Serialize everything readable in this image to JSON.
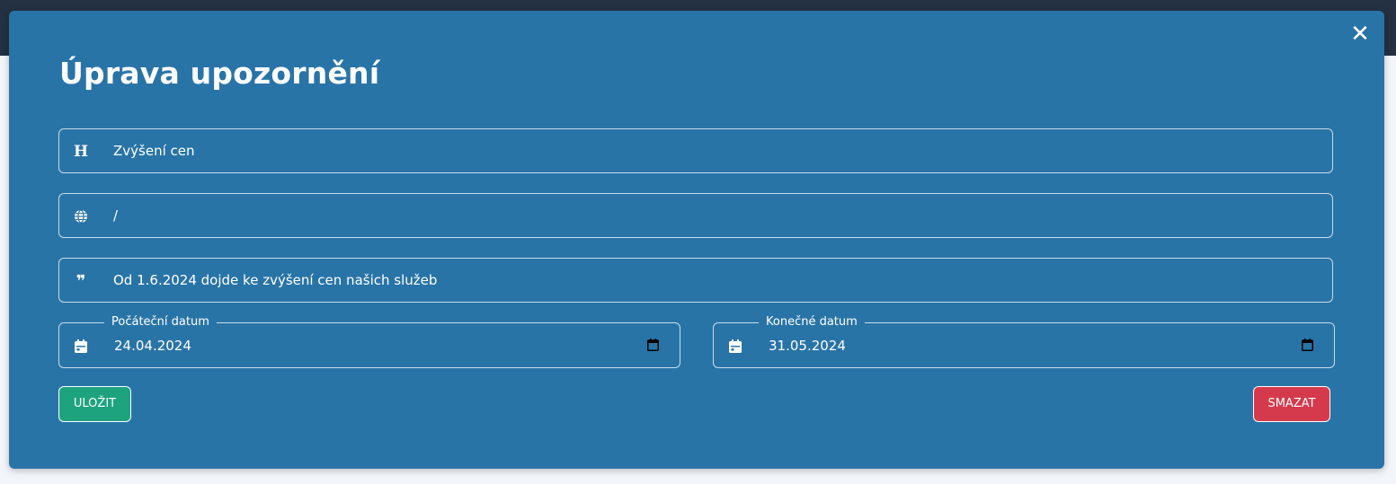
{
  "modal": {
    "title": "Úprava upozornění",
    "close_symbol": "✕"
  },
  "fields": {
    "heading": {
      "icon": "heading-icon",
      "glyph": "H",
      "value": "Zvýšení cen"
    },
    "url": {
      "icon": "globe-icon",
      "value": "/"
    },
    "message": {
      "icon": "quote-icon",
      "glyph": "❞",
      "value": "Od 1.6.2024 dojde ke zvýšení cen našich služeb"
    }
  },
  "dates": {
    "start": {
      "label": "Počáteční datum",
      "value": "24.04.2024",
      "icon": "calendar-icon"
    },
    "end": {
      "label": "Konečné datum",
      "value": "31.05.2024",
      "icon": "calendar-icon"
    }
  },
  "buttons": {
    "save": "ULOŽIT",
    "delete": "SMAZAT"
  },
  "colors": {
    "modal_background": "#2974a7",
    "topbar": "#243142",
    "save_button": "#1ea37f",
    "delete_button": "#d43a4c"
  }
}
